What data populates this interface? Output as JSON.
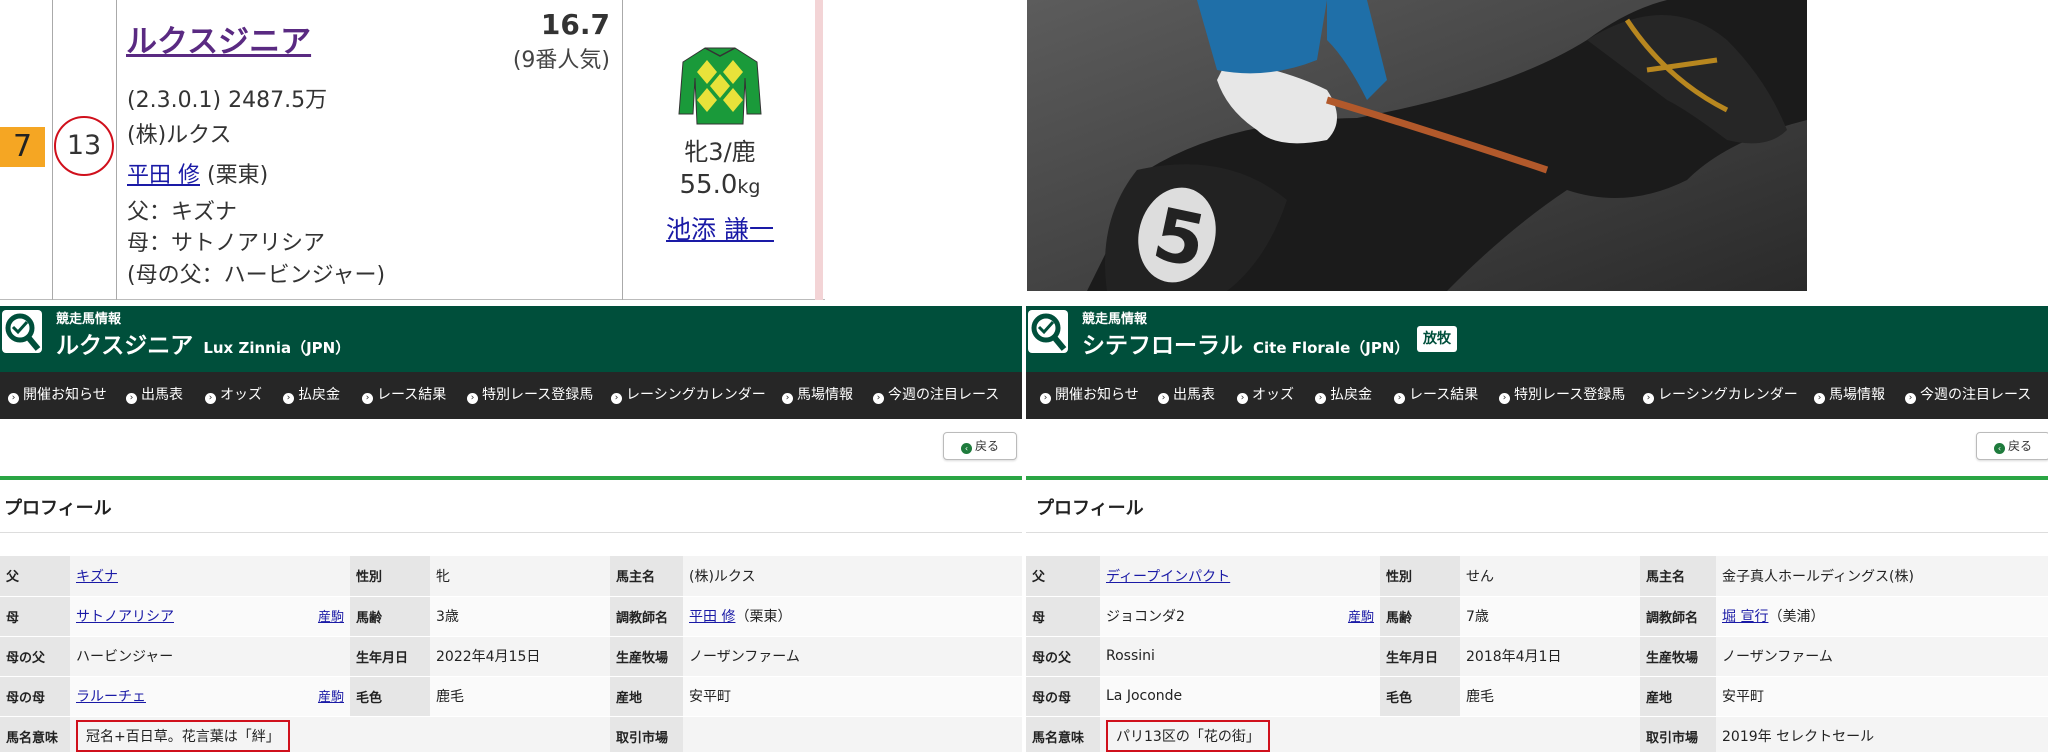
{
  "race_card": {
    "waku": "7",
    "umaban": "13",
    "horse_name": "ルクスジニア",
    "odds": "16.7",
    "popularity": "(9番人気)",
    "record_prize": "(2.3.0.1) 2487.5万",
    "owner": "(株)ルクス",
    "trainer": "平田 修",
    "trainer_region": "(栗東)",
    "sire": "父：キズナ",
    "dam": "母：サトノアリシア",
    "broodmare_sire": "(母の父：ハービンジャー)",
    "sex_age": "牝3/鹿",
    "weight": "55.0",
    "weight_unit": "kg",
    "jockey": "池添 謙一",
    "silks_colors": {
      "main": "#1a9a3a",
      "accent": "#e8e23a"
    }
  },
  "photo": {
    "number_cloth": "5"
  },
  "panels": [
    {
      "header_small": "競走馬情報",
      "horse_name": "ルクスジニア",
      "horse_name_en": "Lux Zinnia（JPN）",
      "badge": "",
      "nav": [
        "開催お知らせ",
        "出馬表",
        "オッズ",
        "払戻金",
        "レース結果",
        "特別レース登録馬",
        "レーシングカレンダー",
        "馬場情報",
        "今週の注目レース"
      ],
      "back_label": "戻る",
      "profile_title": "プロフィール",
      "rows": [
        {
          "k1": "父",
          "v1": "キズナ",
          "v1_link": true,
          "sanku": "",
          "k2": "性別",
          "v2": "牝",
          "k3": "馬主名",
          "v3": "(株)ルクス",
          "v3_link": "",
          "v3_extra": ""
        },
        {
          "k1": "母",
          "v1": "サトノアリシア",
          "v1_link": true,
          "sanku": "産駒",
          "k2": "馬齢",
          "v2": "3歳",
          "k3": "調教師名",
          "v3": "",
          "v3_link": "平田 修",
          "v3_extra": "（栗東）"
        },
        {
          "k1": "母の父",
          "v1": "ハービンジャー",
          "v1_link": false,
          "sanku": "",
          "k2": "生年月日",
          "v2": "2022年4月15日",
          "k3": "生産牧場",
          "v3": "ノーザンファーム",
          "v3_link": "",
          "v3_extra": ""
        },
        {
          "k1": "母の母",
          "v1": "ラルーチェ",
          "v1_link": true,
          "sanku": "産駒",
          "k2": "毛色",
          "v2": "鹿毛",
          "k3": "産地",
          "v3": "安平町",
          "v3_link": "",
          "v3_extra": ""
        }
      ],
      "meaning_label": "馬名意味",
      "meaning": "冠名+百日草。花言葉は「絆」",
      "market_label": "取引市場",
      "market": ""
    },
    {
      "header_small": "競走馬情報",
      "horse_name": "シテフローラル",
      "horse_name_en": "Cite Florale（JPN）",
      "badge": "放牧",
      "nav": [
        "開催お知らせ",
        "出馬表",
        "オッズ",
        "払戻金",
        "レース結果",
        "特別レース登録馬",
        "レーシングカレンダー",
        "馬場情報",
        "今週の注目レース"
      ],
      "back_label": "戻る",
      "profile_title": "プロフィール",
      "rows": [
        {
          "k1": "父",
          "v1": "ディープインパクト",
          "v1_link": true,
          "sanku": "",
          "k2": "性別",
          "v2": "せん",
          "k3": "馬主名",
          "v3": "金子真人ホールディングス(株)",
          "v3_link": "",
          "v3_extra": ""
        },
        {
          "k1": "母",
          "v1": "ジョコンダ2",
          "v1_link": false,
          "sanku": "産駒",
          "k2": "馬齢",
          "v2": "7歳",
          "k3": "調教師名",
          "v3": "",
          "v3_link": "堀 宣行",
          "v3_extra": "（美浦）"
        },
        {
          "k1": "母の父",
          "v1": "Rossini",
          "v1_link": false,
          "sanku": "",
          "k2": "生年月日",
          "v2": "2018年4月1日",
          "k3": "生産牧場",
          "v3": "ノーザンファーム",
          "v3_link": "",
          "v3_extra": ""
        },
        {
          "k1": "母の母",
          "v1": "La Joconde",
          "v1_link": false,
          "sanku": "",
          "k2": "毛色",
          "v2": "鹿毛",
          "k3": "産地",
          "v3": "安平町",
          "v3_link": "",
          "v3_extra": ""
        }
      ],
      "meaning_label": "馬名意味",
      "meaning": "パリ13区の「花の街」",
      "market_label": "取引市場",
      "market": "2019年 セレクトセール"
    }
  ]
}
